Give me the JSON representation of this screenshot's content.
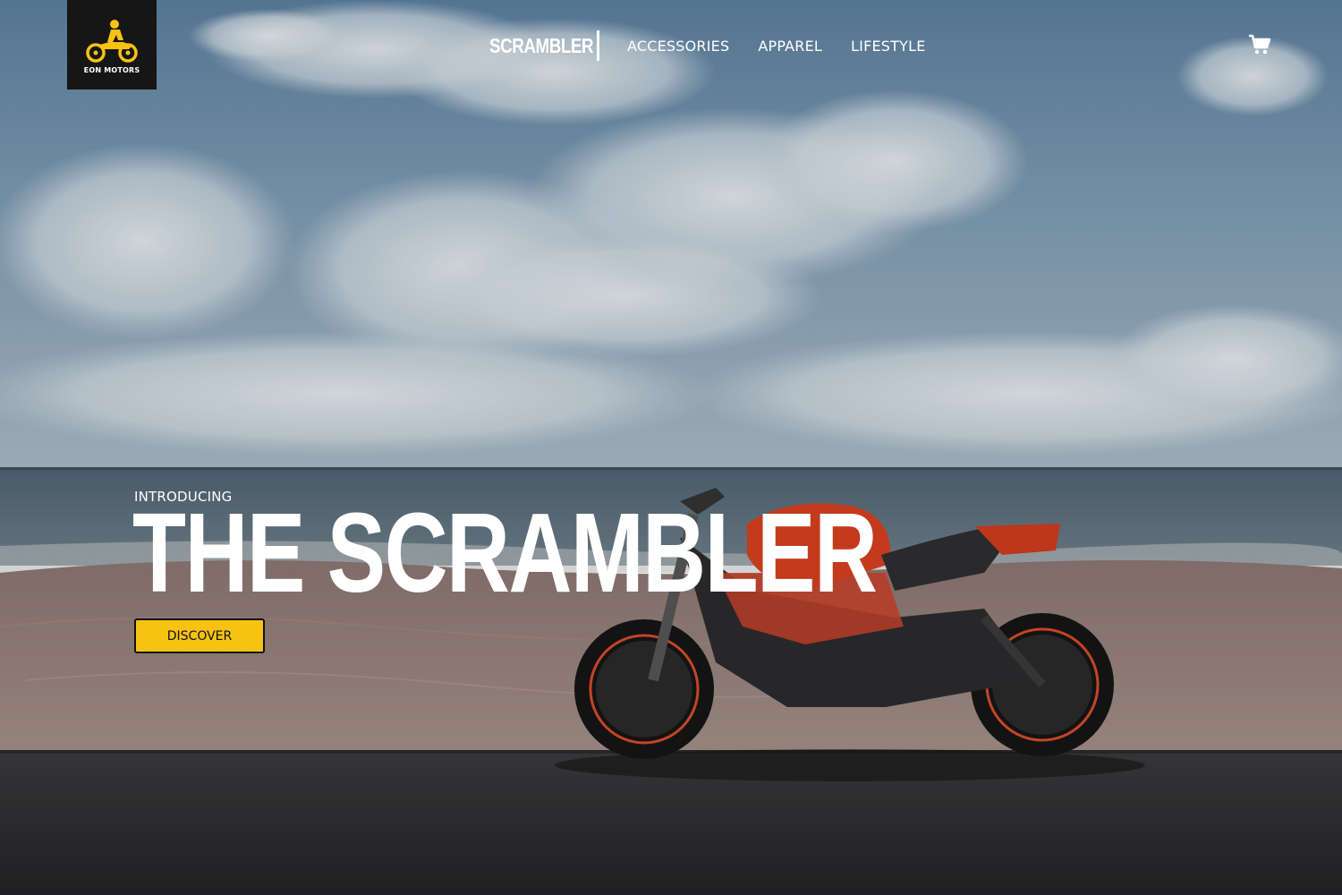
{
  "brand": {
    "logo_text": "EON MOTORS",
    "logo_icon": "motorcycle-rider-icon",
    "accent_color": "#f7c212",
    "logo_bg": "#161616"
  },
  "nav": {
    "brand_label": "SCRAMBLER",
    "links": [
      "ACCESSORIES",
      "APPAREL",
      "LIFESTYLE"
    ],
    "cart_icon": "cart-icon"
  },
  "hero": {
    "eyebrow": "INTRODUCING",
    "headline": "THE SCRAMBLER",
    "cta_label": "DISCOVER",
    "image": "red motorcycle parked on a beach road under a cloudy sky"
  }
}
